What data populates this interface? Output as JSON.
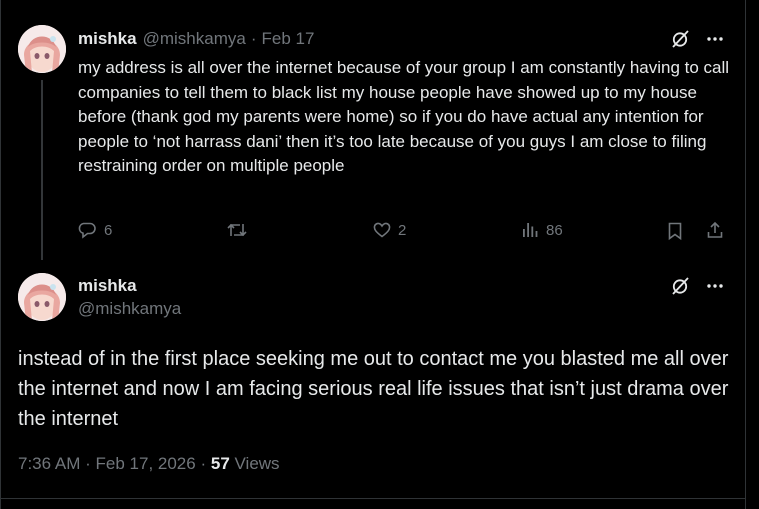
{
  "tweet1": {
    "display_name": "mishka",
    "handle": "@mishkamya",
    "separator": "·",
    "date": "Feb 17",
    "text": "my address is all over the internet because of your group I am constantly having to call companies to tell them to black list my house people have showed up to my house before (thank god my parents were home) so if you do have actual any intention for people to ‘not harrass dani’ then it’s too late because of you guys I am close to filing restraining order on multiple people",
    "actions": {
      "replies": "6",
      "reposts": "",
      "likes": "2",
      "views": "86"
    }
  },
  "tweet2": {
    "display_name": "mishka",
    "handle": "@mishkamya",
    "text": "instead of in the first place seeking me out to contact me you blasted me all over the internet and now I am facing serious real life issues that isn’t just drama over the internet",
    "time": "7:36 AM",
    "date": "Feb 17, 2026",
    "separator": "·",
    "views_count": "57",
    "views_label": "Views"
  },
  "icons": {
    "grok": "grok-icon",
    "more": "more-icon",
    "reply": "reply-icon",
    "repost": "repost-icon",
    "like": "like-icon",
    "views": "views-icon",
    "bookmark": "bookmark-icon",
    "share": "share-icon"
  },
  "colors": {
    "background": "#000000",
    "text": "#e7e9ea",
    "muted": "#71767b",
    "divider": "#2f3336"
  }
}
